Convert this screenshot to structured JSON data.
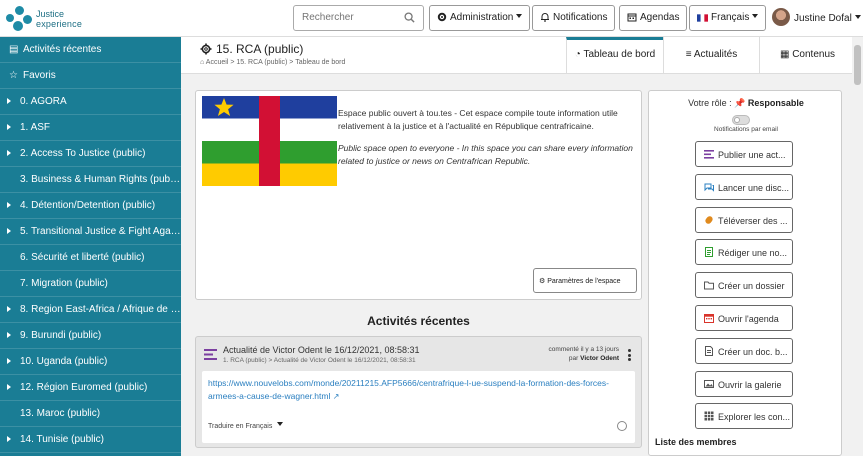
{
  "brand": {
    "line1": "Justice",
    "line2": "experience",
    "color": "#1e8ba6"
  },
  "search": {
    "placeholder": "Rechercher"
  },
  "topnav": {
    "administration": "Administration",
    "notifications": "Notifications",
    "agendas": "Agendas",
    "language": "Français",
    "user": "Justine Dofal"
  },
  "sidebar": {
    "color": "#1a7d95",
    "recent": "Activités récentes",
    "favorites": "Favoris",
    "items": [
      {
        "label": "0. AGORA",
        "expandable": true
      },
      {
        "label": "1. ASF",
        "expandable": true
      },
      {
        "label": "2. Access To Justice (public)",
        "expandable": true
      },
      {
        "label": "3. Business & Human Rights (public)",
        "expandable": false
      },
      {
        "label": "4. Détention/Detention (public)",
        "expandable": true
      },
      {
        "label": "5. Transitional Justice & Fight Again...",
        "expandable": true
      },
      {
        "label": "6. Sécurité et liberté (public)",
        "expandable": false
      },
      {
        "label": "7. Migration (public)",
        "expandable": false
      },
      {
        "label": "8. Region East-Africa / Afrique de l'...",
        "expandable": true
      },
      {
        "label": "9. Burundi (public)",
        "expandable": true
      },
      {
        "label": "10. Uganda (public)",
        "expandable": true
      },
      {
        "label": "12. Région Euromed (public)",
        "expandable": true
      },
      {
        "label": "13. Maroc (public)",
        "expandable": false
      },
      {
        "label": "14. Tunisie (public)",
        "expandable": true
      }
    ]
  },
  "page": {
    "title": "15. RCA (public)",
    "breadcrumb": [
      "Accueil",
      "15. RCA (public)",
      "Tableau de bord"
    ],
    "tabs": [
      {
        "label": "Tableau de bord",
        "active": true
      },
      {
        "label": "Actualités",
        "active": false
      },
      {
        "label": "Contenus",
        "active": false
      }
    ]
  },
  "space": {
    "description_fr": "Espace public ouvert à tou.tes - Cet espace compile toute information utile relativement à la justice et à l'actualité en République centrafricaine.",
    "description_en": "Public space open to everyone - In this space you can share every information related to justice or news on Centrafrican Republic.",
    "settings_button": "Paramètres de l'espace",
    "flag_colors": {
      "blue": "#1f3f9e",
      "white": "#ffffff",
      "green": "#2f9e2f",
      "yellow": "#ffcb00",
      "red": "#d21034",
      "star": "#ffcb00"
    }
  },
  "activities": {
    "title": "Activités récentes",
    "item": {
      "title": "Actualité de Victor Odent le 16/12/2021, 08:58:31",
      "subtitle": "1. RCA (public) > Actualité de Victor Odent le 16/12/2021, 08:58:31",
      "meta_line1": "commenté il y a 13 jours",
      "meta_by": "par",
      "meta_author": "Victor Odent",
      "link": "https://www.nouvelobs.com/monde/20211215.AFP5666/centrafrique-l-ue-suspend-la-formation-des-forces-armees-a-cause-de-wagner.html",
      "translate": "Traduire en Français"
    }
  },
  "rightpanel": {
    "role_label": "Votre rôle :",
    "role_value": "Responsable",
    "notif_label": "Notifications par email",
    "actions": [
      {
        "label": "Publier une act...",
        "icon": "list-icon",
        "color": "#7b3fa0"
      },
      {
        "label": "Lancer une disc...",
        "icon": "comments-icon",
        "color": "#2a7fc0"
      },
      {
        "label": "Téléverser des ...",
        "icon": "paperclip-icon",
        "color": "#e08a1e"
      },
      {
        "label": "Rédiger une no...",
        "icon": "note-icon",
        "color": "#2f9e2f"
      },
      {
        "label": "Créer un dossier",
        "icon": "folder-icon",
        "color": "#555555"
      },
      {
        "label": "Ouvrir l'agenda",
        "icon": "calendar-icon",
        "color": "#d9342b"
      },
      {
        "label": "Créer un doc. b...",
        "icon": "document-icon",
        "color": "#555555"
      },
      {
        "label": "Ouvrir la galerie",
        "icon": "image-icon",
        "color": "#555555"
      },
      {
        "label": "Explorer les con...",
        "icon": "grid-icon",
        "color": "#555555"
      }
    ],
    "members_title": "Liste des membres"
  }
}
